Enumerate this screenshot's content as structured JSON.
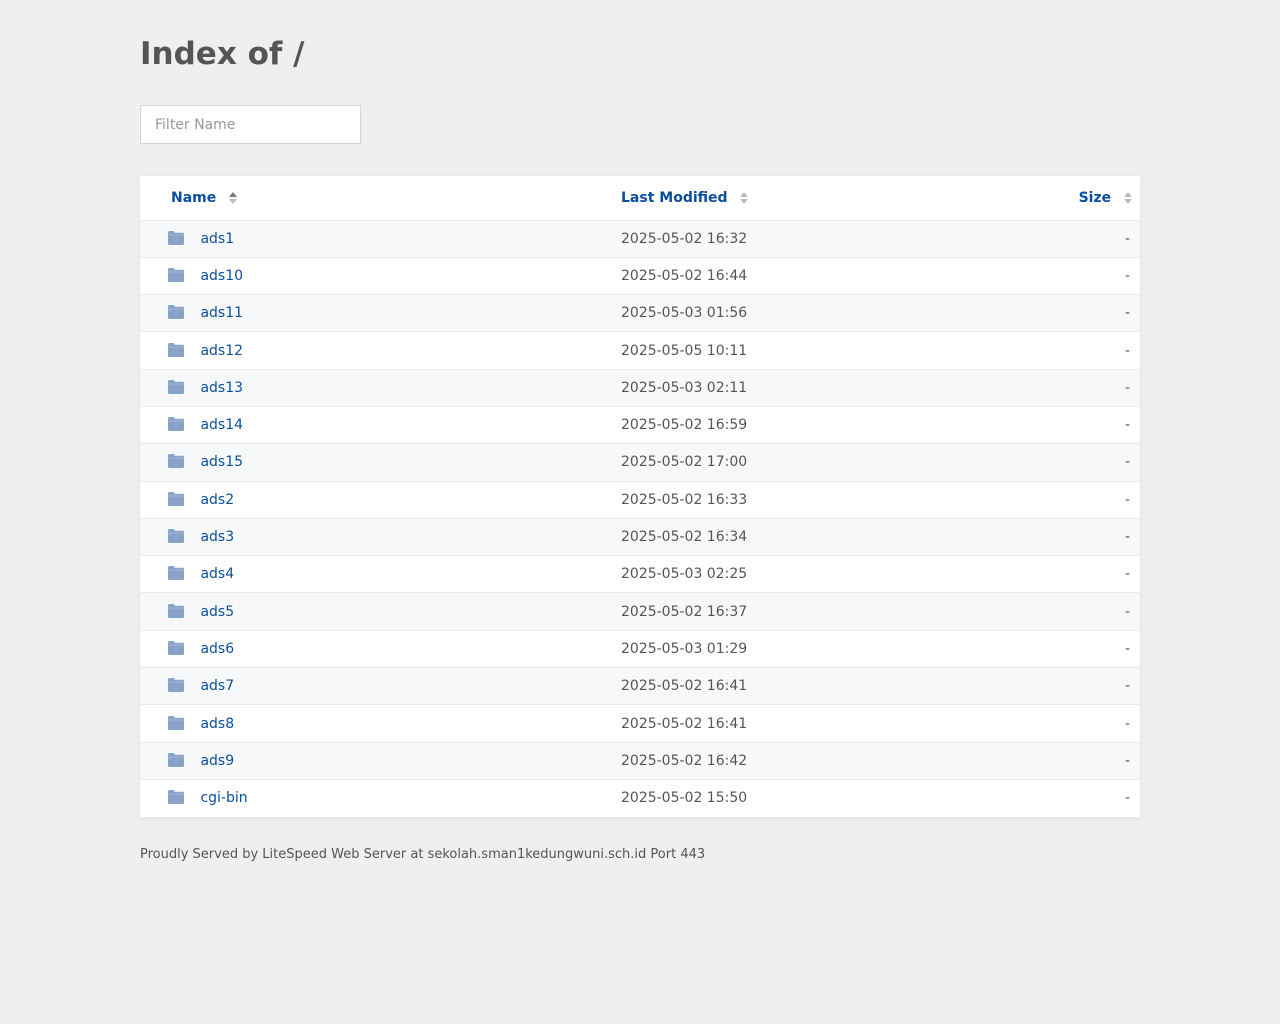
{
  "page": {
    "title": "Index of /"
  },
  "filter": {
    "placeholder": "Filter Name",
    "value": ""
  },
  "table": {
    "headers": {
      "name": "Name",
      "modified": "Last Modified",
      "size": "Size"
    },
    "rows": [
      {
        "name": "ads1",
        "modified": "2025-05-02 16:32",
        "size": "-",
        "icon": "folder-icon"
      },
      {
        "name": "ads10",
        "modified": "2025-05-02 16:44",
        "size": "-",
        "icon": "folder-icon"
      },
      {
        "name": "ads11",
        "modified": "2025-05-03 01:56",
        "size": "-",
        "icon": "folder-icon"
      },
      {
        "name": "ads12",
        "modified": "2025-05-05 10:11",
        "size": "-",
        "icon": "folder-icon"
      },
      {
        "name": "ads13",
        "modified": "2025-05-03 02:11",
        "size": "-",
        "icon": "folder-icon"
      },
      {
        "name": "ads14",
        "modified": "2025-05-02 16:59",
        "size": "-",
        "icon": "folder-icon"
      },
      {
        "name": "ads15",
        "modified": "2025-05-02 17:00",
        "size": "-",
        "icon": "folder-icon"
      },
      {
        "name": "ads2",
        "modified": "2025-05-02 16:33",
        "size": "-",
        "icon": "folder-icon"
      },
      {
        "name": "ads3",
        "modified": "2025-05-02 16:34",
        "size": "-",
        "icon": "folder-icon"
      },
      {
        "name": "ads4",
        "modified": "2025-05-03 02:25",
        "size": "-",
        "icon": "folder-icon"
      },
      {
        "name": "ads5",
        "modified": "2025-05-02 16:37",
        "size": "-",
        "icon": "folder-icon"
      },
      {
        "name": "ads6",
        "modified": "2025-05-03 01:29",
        "size": "-",
        "icon": "folder-icon"
      },
      {
        "name": "ads7",
        "modified": "2025-05-02 16:41",
        "size": "-",
        "icon": "folder-icon"
      },
      {
        "name": "ads8",
        "modified": "2025-05-02 16:41",
        "size": "-",
        "icon": "folder-icon"
      },
      {
        "name": "ads9",
        "modified": "2025-05-02 16:42",
        "size": "-",
        "icon": "folder-icon"
      },
      {
        "name": "cgi-bin",
        "modified": "2025-05-02 15:50",
        "size": "-",
        "icon": "folder-icon"
      }
    ]
  },
  "footer": {
    "text": "Proudly Served by LiteSpeed Web Server at sekolah.sman1kedungwuni.sch.id Port 443"
  },
  "colors": {
    "background": "#eeeff0",
    "link": "#0a4f9e",
    "folder": "#8aa2c8",
    "text": "#555555"
  }
}
